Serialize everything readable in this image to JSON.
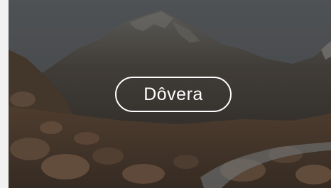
{
  "hero": {
    "button_label": "Dôvera"
  }
}
